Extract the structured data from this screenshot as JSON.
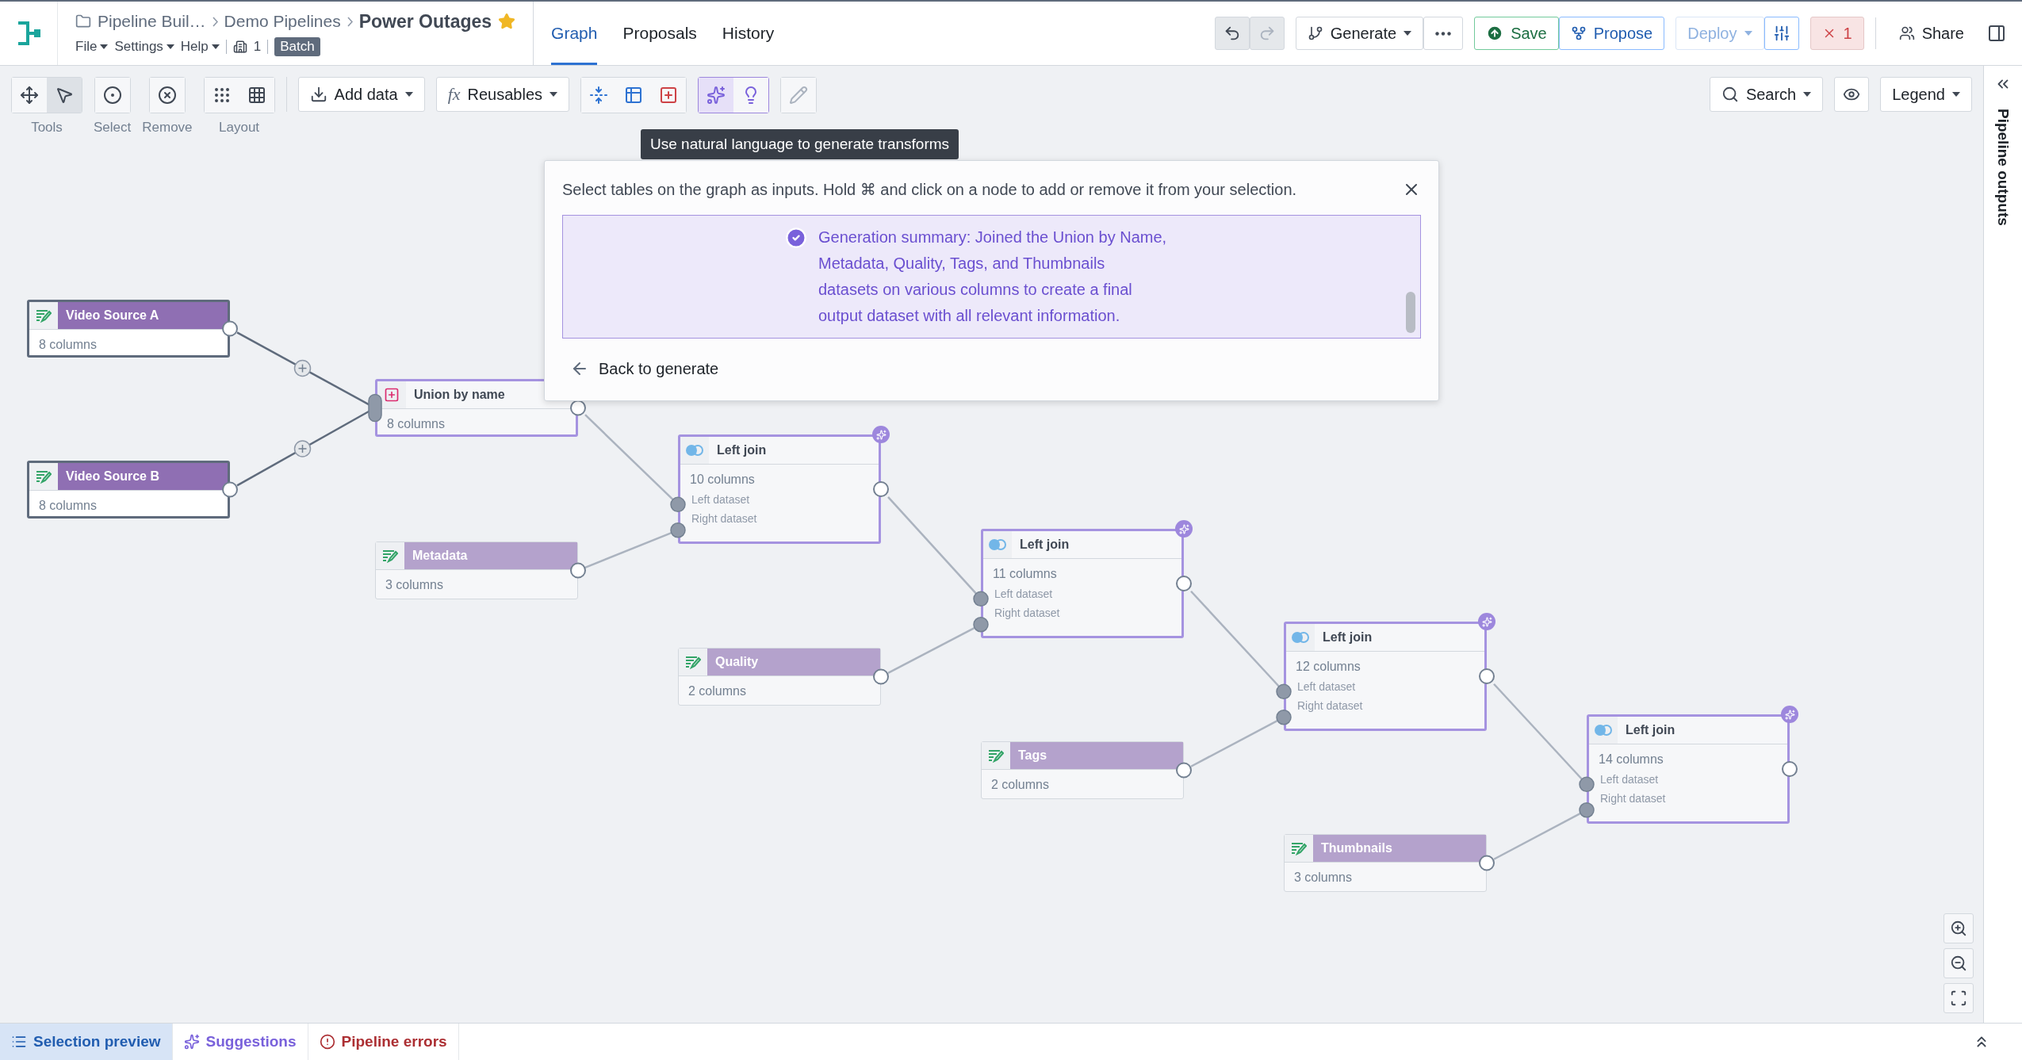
{
  "header": {
    "breadcrumbs": [
      "Pipeline Buil…",
      "Demo Pipelines"
    ],
    "title": "Power Outages",
    "starred": true,
    "menus": [
      "File",
      "Settings",
      "Help"
    ],
    "branch_count": "1",
    "mode": "Batch"
  },
  "tabs": [
    {
      "label": "Graph",
      "selected": true
    },
    {
      "label": "Proposals",
      "selected": false
    },
    {
      "label": "History",
      "selected": false
    }
  ],
  "actions": {
    "generate": "Generate",
    "save": "Save",
    "propose": "Propose",
    "deploy": {
      "label": "Deploy",
      "disabled": true
    },
    "errors": "1",
    "share": "Share"
  },
  "toolbar": {
    "groups": [
      {
        "label": "Tools",
        "buttons": [
          {
            "selected": false
          },
          {
            "selected": true
          }
        ]
      },
      {
        "label": "Select",
        "buttons": [
          {
            "selected": false
          }
        ]
      },
      {
        "label": "Remove",
        "buttons": [
          {
            "selected": false
          }
        ]
      },
      {
        "label": "Layout",
        "buttons": [
          {
            "selected": false
          },
          {
            "selected": false
          }
        ]
      }
    ],
    "add_data": "Add data",
    "reusables": {
      "prefix": "fx",
      "label": "Reusables"
    },
    "groups_right": [
      {
        "buttons": [
          {
            "selected": false
          },
          {
            "selected": false
          },
          {
            "selected": false
          }
        ]
      },
      {
        "buttons": [
          {
            "selected": true
          },
          {
            "selected": false
          }
        ]
      },
      {
        "buttons": [
          {
            "selected": false
          }
        ]
      }
    ],
    "search": "Search",
    "legend": "Legend"
  },
  "tooltip": "Use natural language to generate transforms",
  "popup": {
    "instruction": "Select tables on the graph as inputs. Hold ⌘ and click on a node to add or remove it from your selection.",
    "summary": "Generation summary: Joined the Union by Name, Metadata, Quality, Tags, and Thumbnails datasets on various columns to create a final output dataset with all relevant information.",
    "back": "Back to generate"
  },
  "nodes": [
    {
      "kind": "dataset",
      "title": "Video Source A",
      "subtitle": "8 columns",
      "selected": true
    },
    {
      "kind": "dataset",
      "title": "Video Source B",
      "subtitle": "8 columns",
      "selected": true
    },
    {
      "kind": "union",
      "title": "Union by name",
      "subtitle": "8 columns"
    },
    {
      "kind": "dataset",
      "title": "Metadata",
      "subtitle": "3 columns",
      "selected": false
    },
    {
      "kind": "join",
      "title": "Left join",
      "subtitle": "10 columns",
      "inputs": [
        "Left dataset",
        "Right dataset"
      ]
    },
    {
      "kind": "dataset",
      "title": "Quality",
      "subtitle": "2 columns",
      "selected": false
    },
    {
      "kind": "join",
      "title": "Left join",
      "subtitle": "11 columns",
      "inputs": [
        "Left dataset",
        "Right dataset"
      ]
    },
    {
      "kind": "dataset",
      "title": "Tags",
      "subtitle": "2 columns",
      "selected": false
    },
    {
      "kind": "join",
      "title": "Left join",
      "subtitle": "12 columns",
      "inputs": [
        "Left dataset",
        "Right dataset"
      ]
    },
    {
      "kind": "dataset",
      "title": "Thumbnails",
      "subtitle": "3 columns",
      "selected": false
    },
    {
      "kind": "join",
      "title": "Left join",
      "subtitle": "14 columns",
      "inputs": [
        "Left dataset",
        "Right dataset"
      ]
    }
  ],
  "sidebar": {
    "title": "Pipeline outputs"
  },
  "bottom_tabs": [
    {
      "kind": "preview",
      "label": "Selection preview",
      "selected": true
    },
    {
      "kind": "suggestions",
      "label": "Suggestions",
      "selected": false
    },
    {
      "kind": "errors",
      "label": "Pipeline errors",
      "selected": false
    }
  ]
}
